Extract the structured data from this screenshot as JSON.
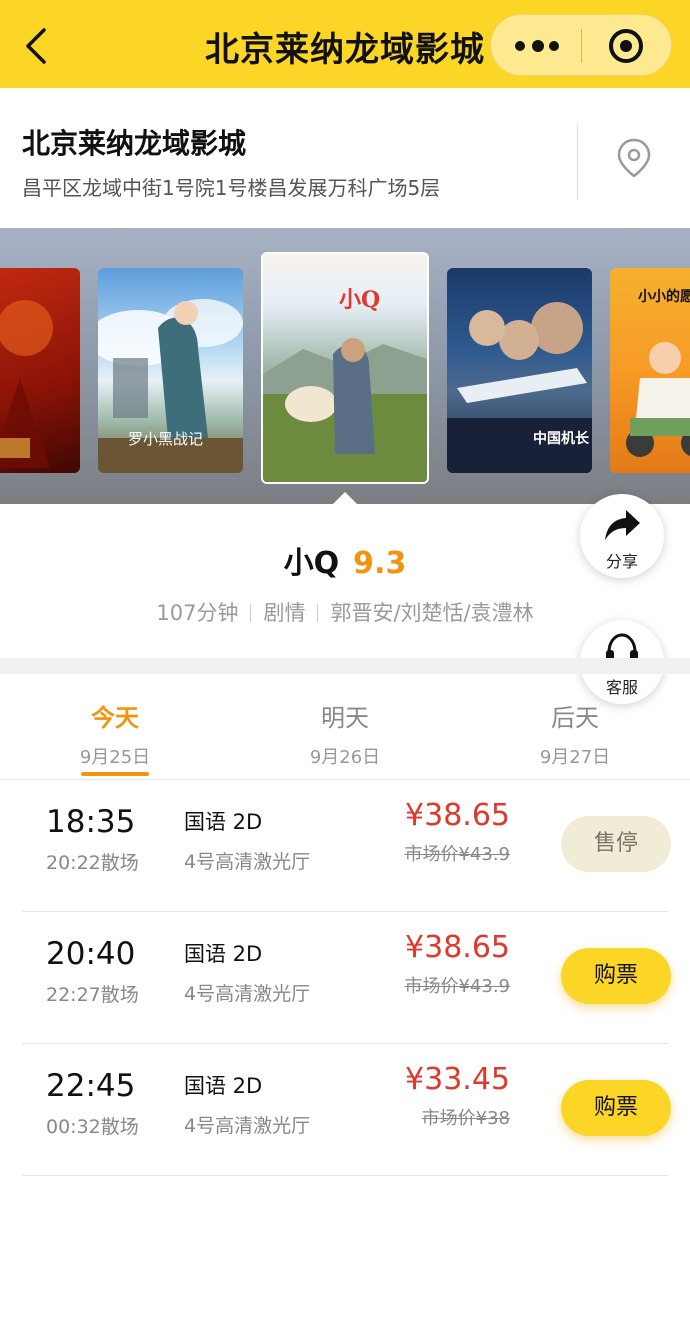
{
  "topbar": {
    "title": "北京莱纳龙域影城"
  },
  "cinema": {
    "name": "北京莱纳龙域影城",
    "address": "昌平区龙域中街1号院1号楼昌发展万科广场5层"
  },
  "movie": {
    "name": "小Q",
    "score": "9.3",
    "duration": "107分钟",
    "genre": "剧情",
    "cast": "郭晋安/刘楚恬/袁澧林"
  },
  "posters": {
    "p2_title": "罗小黑战记",
    "p3_title": "小Q",
    "p4_title": "中国机长",
    "p5_title": "小小的愿望"
  },
  "floats": {
    "share": "分享",
    "service": "客服"
  },
  "dates": [
    {
      "label": "今天",
      "date": "9月25日"
    },
    {
      "label": "明天",
      "date": "9月26日"
    },
    {
      "label": "后天",
      "date": "9月27日"
    }
  ],
  "showtimes": [
    {
      "time": "18:35",
      "end": "20:22散场",
      "lang": "国语 2D",
      "hall": "4号高清激光厅",
      "price": "¥38.65",
      "market": "市场价¥43.9",
      "button": "售停"
    },
    {
      "time": "20:40",
      "end": "22:27散场",
      "lang": "国语 2D",
      "hall": "4号高清激光厅",
      "price": "¥38.65",
      "market": "市场价¥43.9",
      "button": "购票"
    },
    {
      "time": "22:45",
      "end": "00:32散场",
      "lang": "国语 2D",
      "hall": "4号高清激光厅",
      "price": "¥33.45",
      "market": "市场价¥38",
      "button": "购票"
    }
  ],
  "colors": {
    "brand": "#fcd626",
    "accent": "#f3940f",
    "price": "#e2372b"
  }
}
